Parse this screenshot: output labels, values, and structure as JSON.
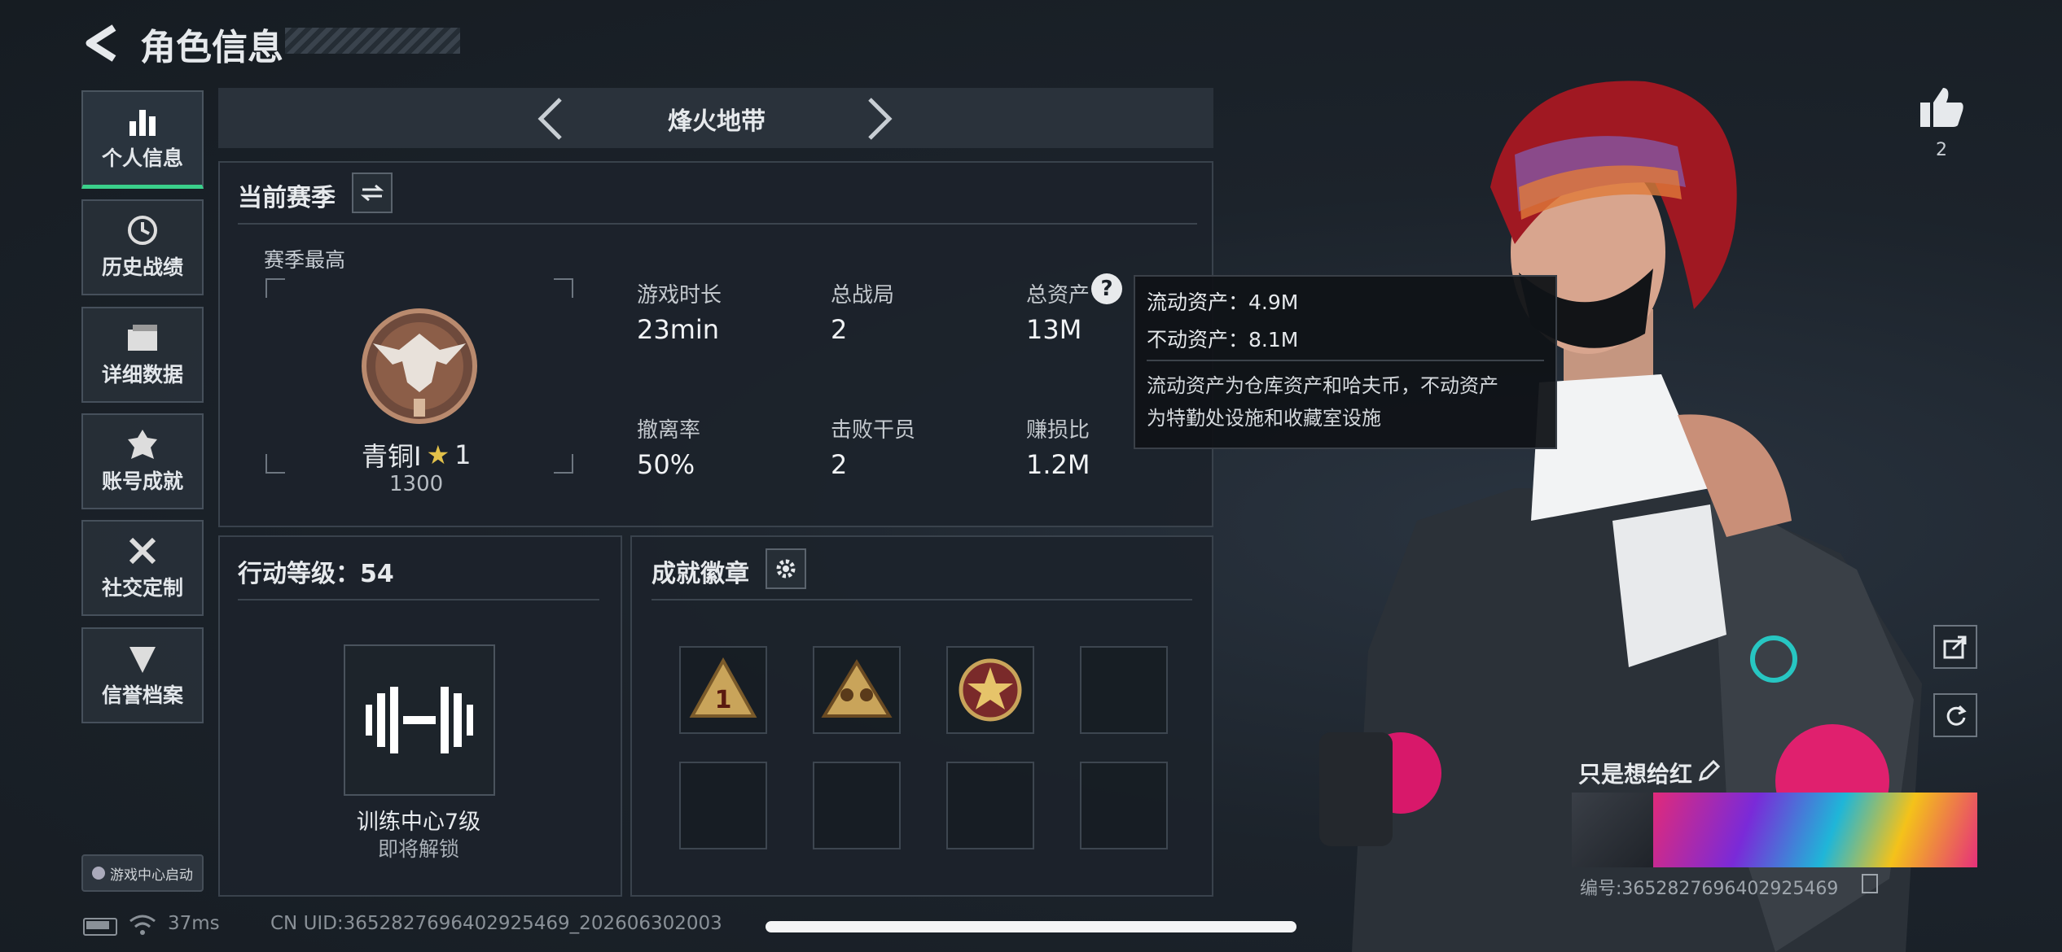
{
  "header": {
    "back_icon": "back-arrow-icon",
    "title": "角色信息"
  },
  "sidebar": {
    "items": [
      {
        "label": "个人信息",
        "icon": "bar-chart-icon",
        "active": true
      },
      {
        "label": "历史战绩",
        "icon": "clock-icon"
      },
      {
        "label": "详细数据",
        "icon": "folder-icon"
      },
      {
        "label": "账号成就",
        "icon": "achievement-icon"
      },
      {
        "label": "社交定制",
        "icon": "tools-icon"
      },
      {
        "label": "信誉档案",
        "icon": "shield-icon"
      }
    ],
    "game_center": "游戏中心启动"
  },
  "mode_selector": {
    "label": "烽火地带"
  },
  "season": {
    "title": "当前赛季",
    "best_label": "赛季最高",
    "rank_name": "青铜I",
    "rank_stars": "1",
    "rank_points": "1300",
    "stats": [
      {
        "label": "游戏时长",
        "value": "23min"
      },
      {
        "label": "总战局",
        "value": "2"
      },
      {
        "label": "总资产",
        "value": "13M"
      },
      {
        "label": "撤离率",
        "value": "50%"
      },
      {
        "label": "击败干员",
        "value": "2"
      },
      {
        "label": "赚损比",
        "value": "1.2M"
      }
    ]
  },
  "tooltip": {
    "liquid": "流动资产：4.9M",
    "fixed": "不动资产：8.1M",
    "desc_line1": "流动资产为仓库资产和哈夫币，不动资产",
    "desc_line2": "为特勤处设施和收藏室设施"
  },
  "action_level": {
    "title": "行动等级：54",
    "training_name": "训练中心7级",
    "training_status": "即将解锁"
  },
  "achievements": {
    "title": "成就徽章"
  },
  "likes": {
    "count": "2"
  },
  "player": {
    "name": "只是想给红",
    "id": "编号:3652827696402925469"
  },
  "status_bar": {
    "ping": "37ms",
    "uid": "CN UID:3652827696402925469_202606302003"
  },
  "colors": {
    "accent_green": "#3ad08b",
    "hair_red": "#a01822",
    "gold": "#c9a45a"
  }
}
